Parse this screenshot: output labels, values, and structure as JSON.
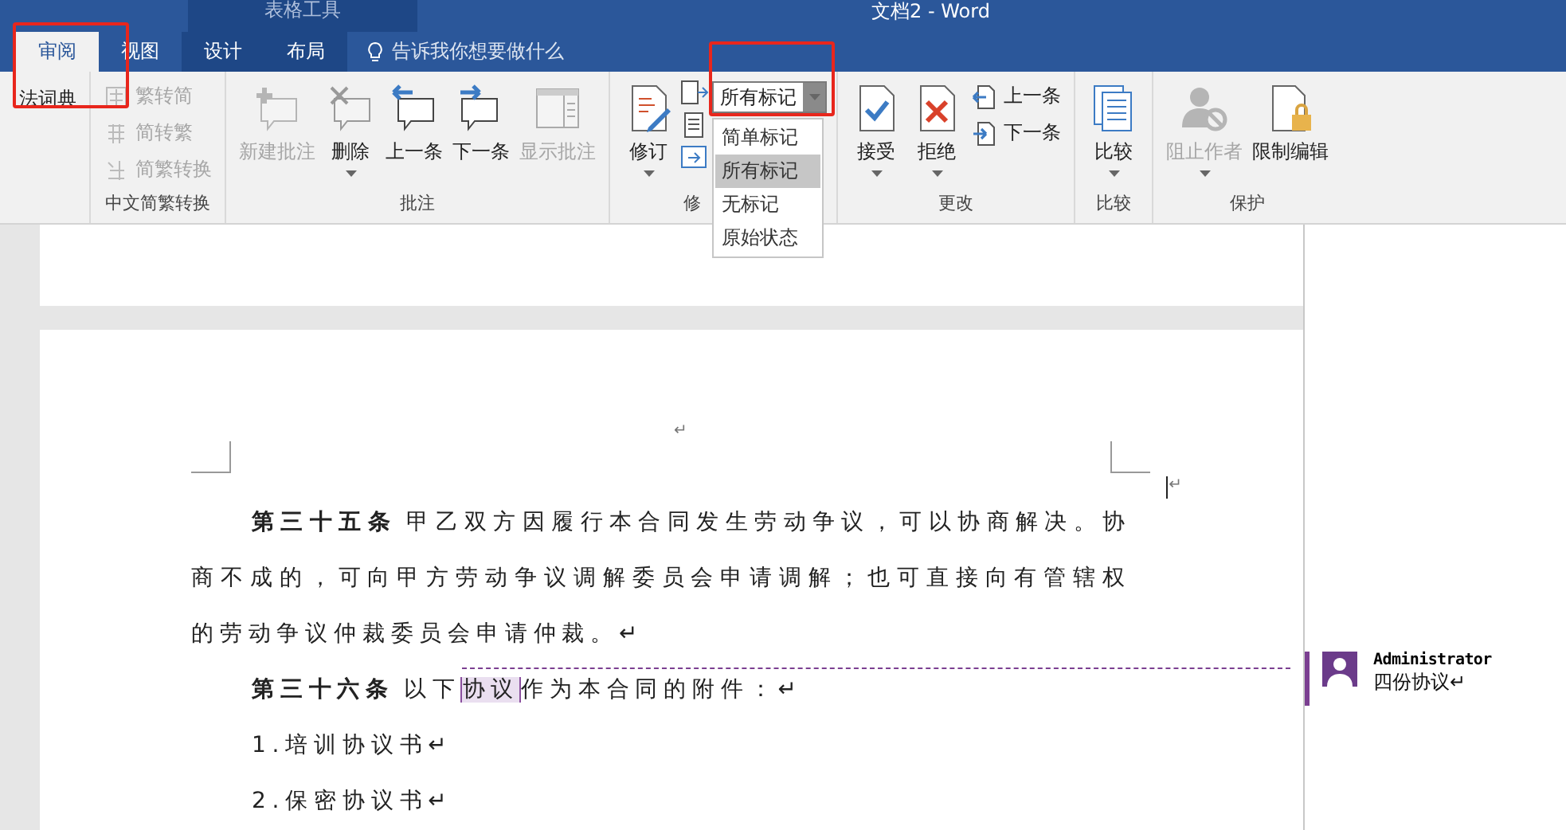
{
  "title_bar": {
    "document_title": "文档2 - Word",
    "context_tab_group": "表格工具"
  },
  "tabs": [
    {
      "label": "审阅",
      "selected": true,
      "contextual": false,
      "marked": true
    },
    {
      "label": "视图",
      "selected": false,
      "contextual": false,
      "marked": false
    },
    {
      "label": "设计",
      "selected": false,
      "contextual": true,
      "marked": false
    },
    {
      "label": "布局",
      "selected": false,
      "contextual": true,
      "marked": false
    }
  ],
  "tell_me": {
    "placeholder": "告诉我你想要做什么"
  },
  "ribbon": {
    "cut_button": "法词典",
    "groups": [
      {
        "label": "中文简繁转换",
        "items": [
          {
            "kind": "small",
            "label": "繁转简",
            "disabled": true
          },
          {
            "kind": "small",
            "label": "简转繁",
            "disabled": true
          },
          {
            "kind": "small",
            "label": "简繁转换",
            "disabled": true
          }
        ]
      },
      {
        "label": "批注",
        "items": [
          {
            "kind": "large",
            "label": "新建批注",
            "disabled": true,
            "dropdown": false
          },
          {
            "kind": "large",
            "label": "删除",
            "disabled": false,
            "dropdown": true
          },
          {
            "kind": "large",
            "label": "上一条",
            "disabled": false,
            "dropdown": false
          },
          {
            "kind": "large",
            "label": "下一条",
            "disabled": false,
            "dropdown": false
          },
          {
            "kind": "large",
            "label": "显示批注",
            "disabled": true,
            "dropdown": false
          }
        ]
      },
      {
        "label": "修",
        "items": [
          {
            "kind": "large",
            "label": "修订",
            "disabled": false,
            "dropdown": true
          },
          {
            "kind": "icons"
          },
          {
            "kind": "combo",
            "value": "所有标记",
            "expanded": true,
            "marked": true,
            "options": [
              {
                "label": "简单标记",
                "selected": false
              },
              {
                "label": "所有标记",
                "selected": true
              },
              {
                "label": "无标记",
                "selected": false
              },
              {
                "label": "原始状态",
                "selected": false
              }
            ]
          }
        ]
      },
      {
        "label": "更改",
        "items": [
          {
            "kind": "large",
            "label": "接受",
            "disabled": false,
            "dropdown": true
          },
          {
            "kind": "large",
            "label": "拒绝",
            "disabled": false,
            "dropdown": true
          },
          {
            "kind": "small",
            "label": "上一条",
            "disabled": false
          },
          {
            "kind": "small",
            "label": "下一条",
            "disabled": false
          }
        ]
      },
      {
        "label": "比较",
        "items": [
          {
            "kind": "large",
            "label": "比较",
            "disabled": false,
            "dropdown": true
          }
        ]
      },
      {
        "label": "保护",
        "items": [
          {
            "kind": "large",
            "label": "阻止作者",
            "disabled": true,
            "dropdown": true
          },
          {
            "kind": "large",
            "label": "限制编辑",
            "disabled": false,
            "dropdown": false
          }
        ]
      }
    ]
  },
  "document": {
    "top_mark": "↵",
    "margin_mark": "↵",
    "paragraphs": [
      {
        "kind": "article",
        "lead": "第三十五条",
        "text": "甲乙双方因履行本合同发生劳动争议，可以协商解决。协商不成的，可向甲方劳动争议调解委员会申请调解；也可直接向有管辖权的劳动争议仲裁委员会申请仲裁。↵"
      },
      {
        "kind": "article",
        "lead": "第三十六条",
        "text": "以下",
        "anchor": "协议",
        "text_after": "作为本合同的附件：↵"
      },
      {
        "kind": "item",
        "text": "1.培训协议书↵"
      },
      {
        "kind": "item",
        "text": "2.保密协议书↵"
      }
    ]
  },
  "comment": {
    "author": "Administrator",
    "text": "四份协议↵"
  }
}
